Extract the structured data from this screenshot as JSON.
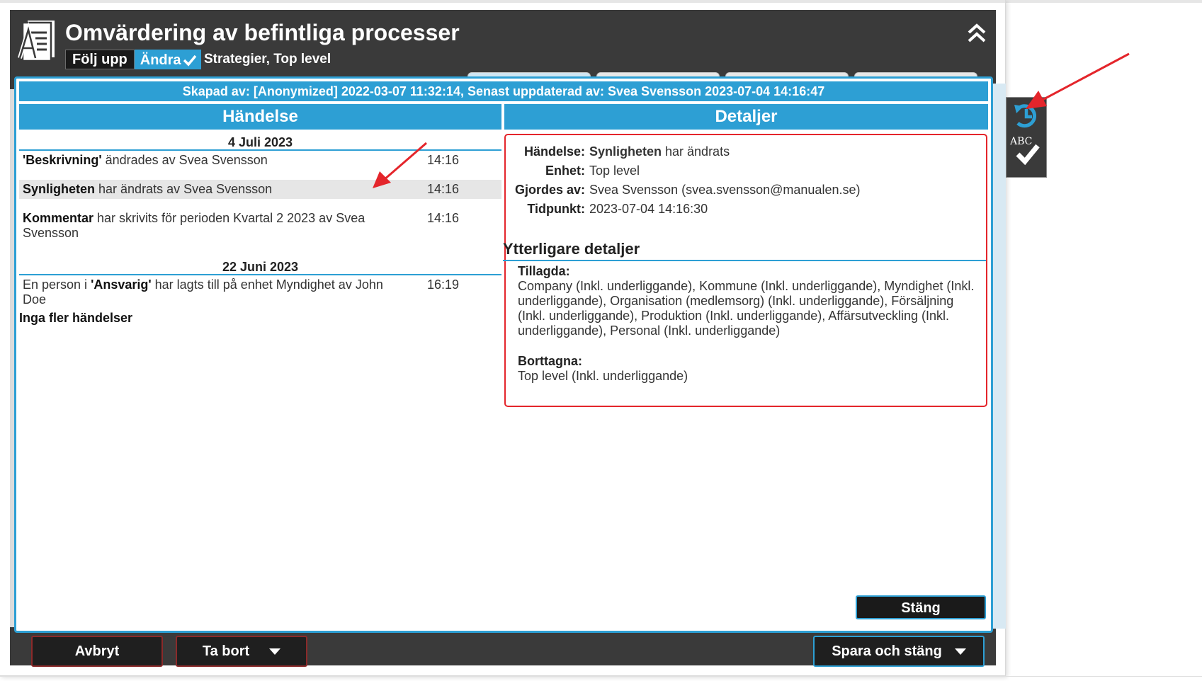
{
  "header": {
    "title": "Omvärdering av befintliga processer",
    "tab_follow": "Följ upp",
    "tab_change": "Ändra",
    "breadcrumb": "Strategier, Top level"
  },
  "dialog": {
    "created_bar": "Skapad av: [Anonymized] 2022-03-07 11:32:14, Senast uppdaterad av: Svea Svensson 2023-07-04 14:16:47",
    "left_header": "Händelse",
    "right_header": "Detaljer",
    "groups": [
      {
        "date": "4 Juli 2023",
        "events": [
          {
            "bold": "'Beskrivning'",
            "text": " ändrades av Svea Svensson",
            "time": "14:16"
          },
          {
            "bold": "Synligheten",
            "text": " har ändrats av Svea Svensson",
            "time": "14:16"
          },
          {
            "bold": "Kommentar",
            "text": " har skrivits för perioden Kvartal 2 2023 av Svea Svensson",
            "time": "14:16"
          }
        ]
      },
      {
        "date": "22 Juni 2023",
        "events": [
          {
            "pre": "En person i ",
            "bold": "'Ansvarig'",
            "text": " har lagts till på enhet Myndighet av John Doe",
            "time": "16:19"
          }
        ]
      }
    ],
    "no_more": "Inga fler händelser",
    "details": {
      "event_label": "Händelse:",
      "event_value_bold": "Synligheten",
      "event_value_rest": " har ändrats",
      "unit_label": "Enhet:",
      "unit_value": "Top level",
      "by_label": "Gjordes av:",
      "by_value": "Svea Svensson (svea.svensson@manualen.se)",
      "time_label": "Tidpunkt:",
      "time_value": "2023-07-04 14:16:30",
      "more_title": "Ytterligare detaljer",
      "added_label": "Tillagda:",
      "added_value": "Company (Inkl. underliggande), Kommune (Inkl. underliggande), Myndighet (Inkl. underliggande), Organisation (medlemsorg) (Inkl. underliggande), Försäljning (Inkl. underliggande), Produktion (Inkl. underliggande), Affärsutveckling (Inkl. underliggande), Personal (Inkl. underliggande)",
      "removed_label": "Borttagna:",
      "removed_value": "Top level (Inkl. underliggande)"
    },
    "close_label": "Stäng"
  },
  "footer": {
    "cancel_label": "Avbryt",
    "delete_label": "Ta bort",
    "save_label": "Spara och stäng"
  },
  "side_tool": {
    "abc_label": "ABC"
  },
  "colors": {
    "accent": "#2d9fd4",
    "dark": "#3a3a3a",
    "annotation": "#e4252b"
  }
}
